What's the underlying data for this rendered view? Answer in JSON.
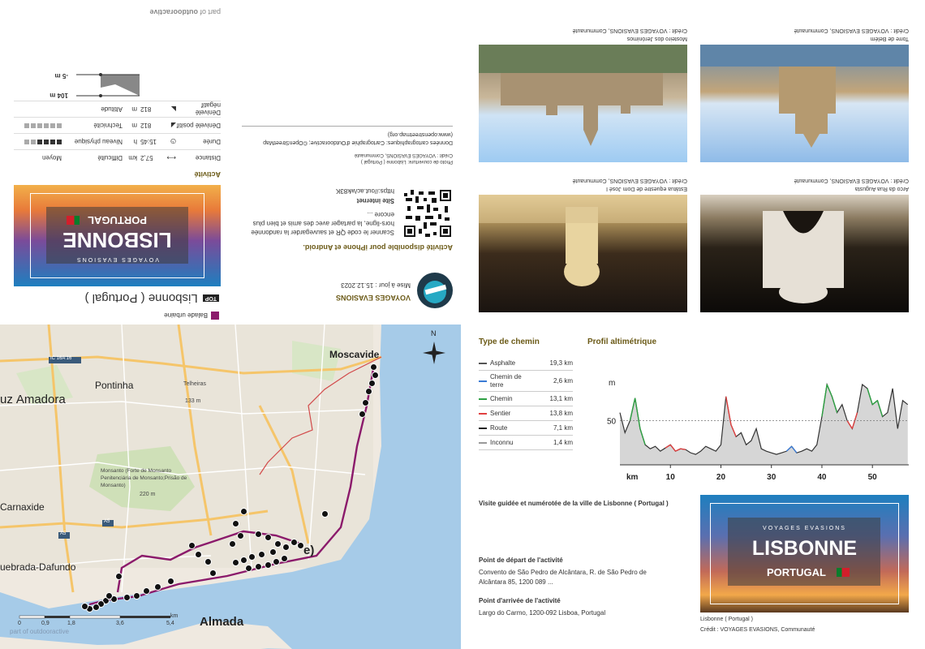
{
  "brand": {
    "part_of": "part of ",
    "outdooractive": "outdooractive"
  },
  "activity_card": {
    "category": "Balade urbaine",
    "top_badge": "TOP",
    "title": "Lisbonne ( Portugal )",
    "cover_title": "LISBONNE",
    "cover_subtitle": "PORTUGAL",
    "cover_tagline": "VOYAGES EVASIONS"
  },
  "stats": {
    "section_title": "Activité",
    "rows": [
      {
        "label": "Distance",
        "value": "57,2",
        "unit": "km",
        "label2": "Difficulté",
        "value2": "Moyen"
      },
      {
        "label": "Durée",
        "value": "15:45",
        "unit": "h",
        "label2": "Niveau physique",
        "value2": ""
      },
      {
        "label": "Dénivelé positif",
        "value": "812",
        "unit": "m",
        "label2": "Technicité",
        "value2": ""
      },
      {
        "label": "Dénivelé négatif",
        "value": "812",
        "unit": "m",
        "label2": "Altitude",
        "value2": ""
      }
    ],
    "altitude_max": "104 m",
    "altitude_min": "-5 m"
  },
  "author": {
    "name": "VOYAGES EVASIONS",
    "updated": "Mise à jour : 15.12.2023"
  },
  "app": {
    "headline": "Activité disponible pour iPhone et Android.",
    "text": "Scanner le code QR et sauvegarder la randonnée hors-ligne, la partager avec des amis et bien plus encore ...",
    "site_label": "Site internet",
    "url": "https://out.ac/wk83K"
  },
  "credits": {
    "cover": "Photo de couverture: Lisbonne ( Portugal )",
    "cover_credit": "Crédit : VOYAGES EVASIONS, Communauté",
    "map_data": "Données cartographiques: Cartographie d'Outdooractive; ©OpenStreetMap (www.openstreetmap.org)"
  },
  "photos": [
    {
      "caption": "Mosteiro dos Jerónimos",
      "credit": "Crédit : VOYAGES EVASIONS, Communauté"
    },
    {
      "caption": "Torre de Belém",
      "credit": "Crédit : VOYAGES EVASIONS, Communauté"
    },
    {
      "caption": "Estátua equestre de Dom José I",
      "credit": "Crédit : VOYAGES EVASIONS, Communauté"
    },
    {
      "caption": "Arco da Rua Augusta",
      "credit": "Crédit : VOYAGES EVASIONS, Communauté"
    }
  ],
  "map": {
    "labels": {
      "moscavide": "Moscavide",
      "pontinha": "Pontinha",
      "amadora": "Amadora",
      "amadora_prefix": "uz",
      "carnaxide": "Carnaxide",
      "quebrada": "uebrada-Dafundo",
      "almada": "Almada",
      "telheiras": "Telheiras",
      "telheiras_alt": "133 m",
      "monsanto": "Monsanto (Forte de Monsanto Penitenciária de Monsanto;Prisão de Monsanto)",
      "monsanto_alt": "220 m",
      "ic16": "IC 16A 16",
      "a5a": "A5",
      "a5b": "A5",
      "cut": "e)",
      "north": "N"
    },
    "scale": [
      "0",
      "0,9",
      "1,8",
      "3,6",
      "5,4"
    ],
    "scale_unit": "km",
    "watermark": "part of outdooractive",
    "colors": {
      "route": "#8b1a6b",
      "water": "#a6cbe8",
      "land": "#f2efe9"
    }
  },
  "path_types": {
    "title": "Type de chemin",
    "rows": [
      {
        "name": "Asphalte",
        "km": "19,3 km",
        "color": "#555555"
      },
      {
        "name": "Chemin de terre",
        "km": "2,6 km",
        "color": "#3a7bd5"
      },
      {
        "name": "Chemin",
        "km": "13,1 km",
        "color": "#2ea043"
      },
      {
        "name": "Sentier",
        "km": "13,8 km",
        "color": "#e04040"
      },
      {
        "name": "Route",
        "km": "7,1 km",
        "color": "#222222"
      },
      {
        "name": "Inconnu",
        "km": "1,4 km",
        "color": "#999999"
      }
    ]
  },
  "profile": {
    "title": "Profil altimétrique",
    "y_unit": "m",
    "y_tick": "50",
    "x_unit": "km",
    "x_ticks": [
      "10",
      "20",
      "30",
      "40",
      "50"
    ]
  },
  "chart_data": {
    "type": "area",
    "title": "Profil altimétrique",
    "xlabel": "km",
    "ylabel": "m",
    "xlim": [
      0,
      57.2
    ],
    "ylim": [
      -5,
      104
    ],
    "x": [
      0,
      1,
      2,
      3,
      4,
      5,
      6,
      7,
      8,
      9,
      10,
      11,
      12,
      13,
      14,
      15,
      16,
      17,
      18,
      19,
      20,
      21,
      22,
      23,
      24,
      25,
      26,
      27,
      28,
      29,
      30,
      31,
      32,
      33,
      34,
      35,
      36,
      37,
      38,
      39,
      40,
      41,
      42,
      43,
      44,
      45,
      46,
      47,
      48,
      49,
      50,
      51,
      52,
      53,
      54,
      55,
      56,
      57
    ],
    "values": [
      60,
      35,
      50,
      78,
      40,
      20,
      15,
      18,
      12,
      16,
      20,
      12,
      15,
      14,
      10,
      8,
      12,
      18,
      15,
      12,
      20,
      80,
      45,
      30,
      35,
      20,
      25,
      40,
      15,
      12,
      10,
      8,
      10,
      12,
      18,
      10,
      12,
      15,
      12,
      20,
      55,
      95,
      80,
      60,
      70,
      50,
      40,
      60,
      95,
      90,
      70,
      75,
      55,
      60,
      90,
      40,
      75,
      70
    ]
  },
  "summary": {
    "headline": "Visite guidée et numérotée de la ville de Lisbonne ( Portugal )",
    "start_title": "Point de départ de l'activité",
    "start_text": "Convento de São Pedro de Alcântara, R. de São Pedro de Alcântara 85, 1200 089 ...",
    "end_title": "Point d'arrivée de l'activité",
    "end_text": "Largo do Carmo, 1200-092 Lisboa, Portugal",
    "cover_caption": "Lisbonne ( Portugal )",
    "cover_credit": "Crédit : VOYAGES EVASIONS, Communauté",
    "cover_title": "LISBONNE",
    "cover_subtitle": "PORTUGAL",
    "cover_tagline": "VOYAGES EVASIONS"
  }
}
